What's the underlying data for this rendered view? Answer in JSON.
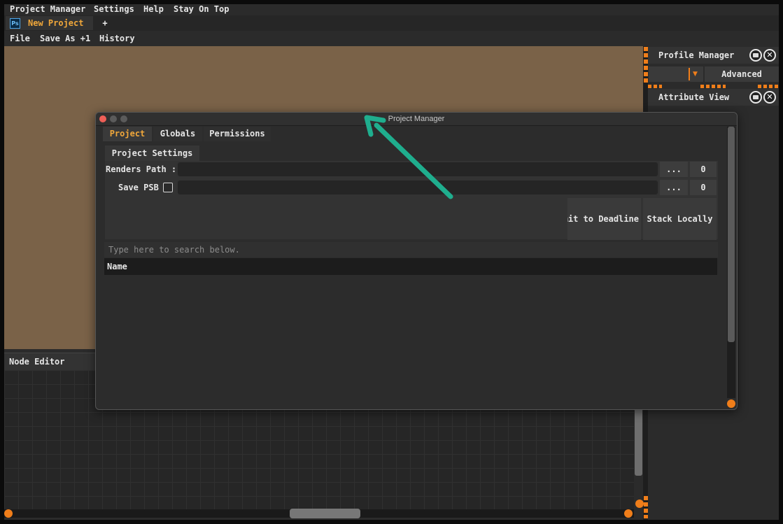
{
  "menubar": {
    "items": [
      "Project Manager",
      "Settings",
      "Help",
      "Stay On Top"
    ]
  },
  "tabs": {
    "project_tab": "New Project",
    "ps_icon": "Ps",
    "add_tab": "+"
  },
  "secondary_menu": {
    "items": [
      "File",
      "Save As +1",
      "History"
    ]
  },
  "node_editor": {
    "title": "Node Editor"
  },
  "profile_manager": {
    "title": "Profile Manager",
    "combo_value": "",
    "advanced_label": "Advanced"
  },
  "attribute_view": {
    "title": "Attribute View"
  },
  "icons": {
    "float": "float-icon",
    "close": "close-icon",
    "close_glyph": "✕",
    "dropdown_glyph": "▼"
  },
  "dialog": {
    "title": "Project Manager",
    "tabs": [
      "Project",
      "Globals",
      "Permissions"
    ],
    "active_tab": "Project",
    "subtab": "Project Settings",
    "renders_path_label": "Renders Path :",
    "renders_path_value": "",
    "renders_browse": "...",
    "renders_count": "0",
    "save_psb_label": "Save PSB",
    "save_psb_checked": false,
    "save_psb_value": "",
    "save_psb_browse": "...",
    "save_psb_count": "0",
    "submit_label": "Submit to Deadline",
    "stack_label": "Stack Locally",
    "search_placeholder": "Type here to search below.",
    "list_header": "Name"
  },
  "colors": {
    "accent": "#f07e1a",
    "active_tab_text": "#f0a73a",
    "annotation_arrow": "#1fae8e",
    "viewport": "#7a6248"
  }
}
